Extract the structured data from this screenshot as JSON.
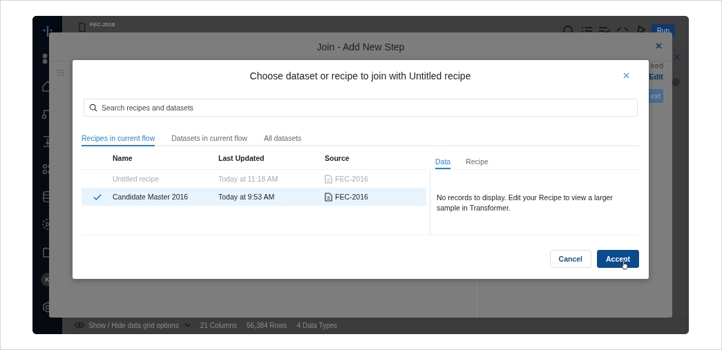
{
  "app": {
    "file_label": "FEC-2016",
    "run_button": "Run",
    "avatar": "K",
    "status_bar": {
      "grid_options": "Show / Hide data grid options",
      "columns": "21 Columns",
      "rows": "56,384 Rows",
      "data_types": "4 Data Types"
    }
  },
  "step_modal": {
    "title": "Join - Add New Step",
    "side_panel": {
      "status": "ired",
      "edit_link": "Edit",
      "next_button": "ext"
    }
  },
  "dialog": {
    "title": "Choose dataset or recipe to join with Untitled recipe",
    "search": {
      "placeholder": "Search recipes and datasets"
    },
    "tabs": [
      {
        "label": "Recipes in current flow",
        "selected": true
      },
      {
        "label": "Datasets in current flow",
        "selected": false
      },
      {
        "label": "All datasets",
        "selected": false
      }
    ],
    "table": {
      "columns": [
        "Name",
        "Last Updated",
        "Source"
      ],
      "rows": [
        {
          "name": "Untitled recipe",
          "updated": "Today at 11:18 AM",
          "source": "FEC-2016",
          "selected": false,
          "disabled": true
        },
        {
          "name": "Candidate Master 2016",
          "updated": "Today at 9:53 AM",
          "source": "FEC-2016",
          "selected": true,
          "disabled": false
        }
      ]
    },
    "preview": {
      "tabs": [
        {
          "label": "Data",
          "selected": true
        },
        {
          "label": "Recipe",
          "selected": false
        }
      ],
      "message": "No records to display. Edit your Recipe to view a larger sample in Transformer."
    },
    "buttons": {
      "cancel": "Cancel",
      "accept": "Accept"
    }
  }
}
